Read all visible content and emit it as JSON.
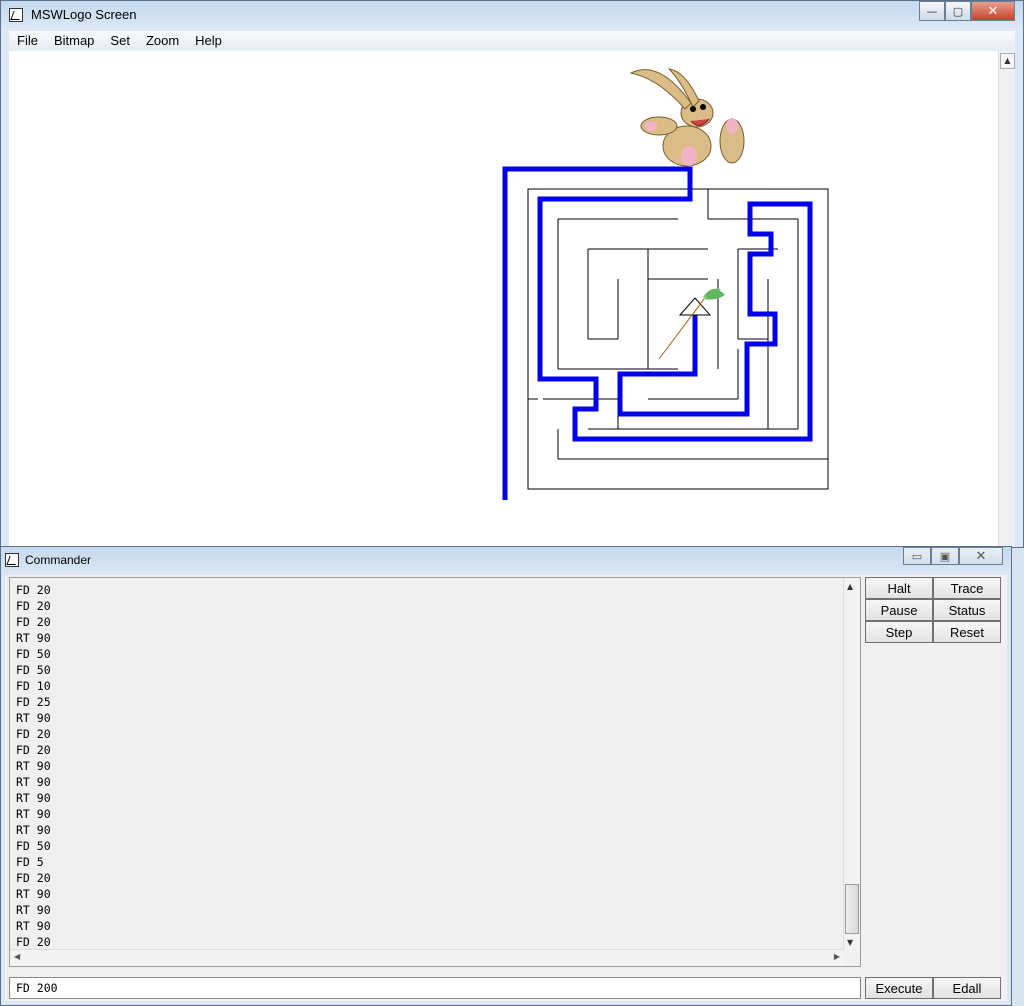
{
  "main_window": {
    "title": "MSWLogo Screen",
    "menu": [
      "File",
      "Bitmap",
      "Set",
      "Zoom",
      "Help"
    ],
    "caption_buttons": {
      "minimize": "—",
      "maximize": "▢",
      "close": "✕"
    }
  },
  "commander": {
    "title": "Commander",
    "history": [
      "FD 20",
      "FD 20",
      "FD 20",
      "RT 90",
      "FD 50",
      "FD 50",
      "FD 10",
      "FD 25",
      "RT 90",
      "FD 20",
      "FD 20",
      "RT 90",
      "RT 90",
      "RT 90",
      "RT 90",
      "RT 90",
      "FD 50",
      "FD 5",
      "FD 20",
      "RT 90",
      "RT 90",
      "RT 90",
      "FD 20"
    ],
    "input_value": "FD 200",
    "buttons": {
      "halt": "Halt",
      "trace": "Trace",
      "pause": "Pause",
      "status": "Status",
      "step": "Step",
      "reset": "Reset",
      "execute": "Execute",
      "edall": "Edall"
    }
  },
  "colors": {
    "path": "#0000ee",
    "maze": "#000000",
    "canvas": "#ffffff"
  }
}
